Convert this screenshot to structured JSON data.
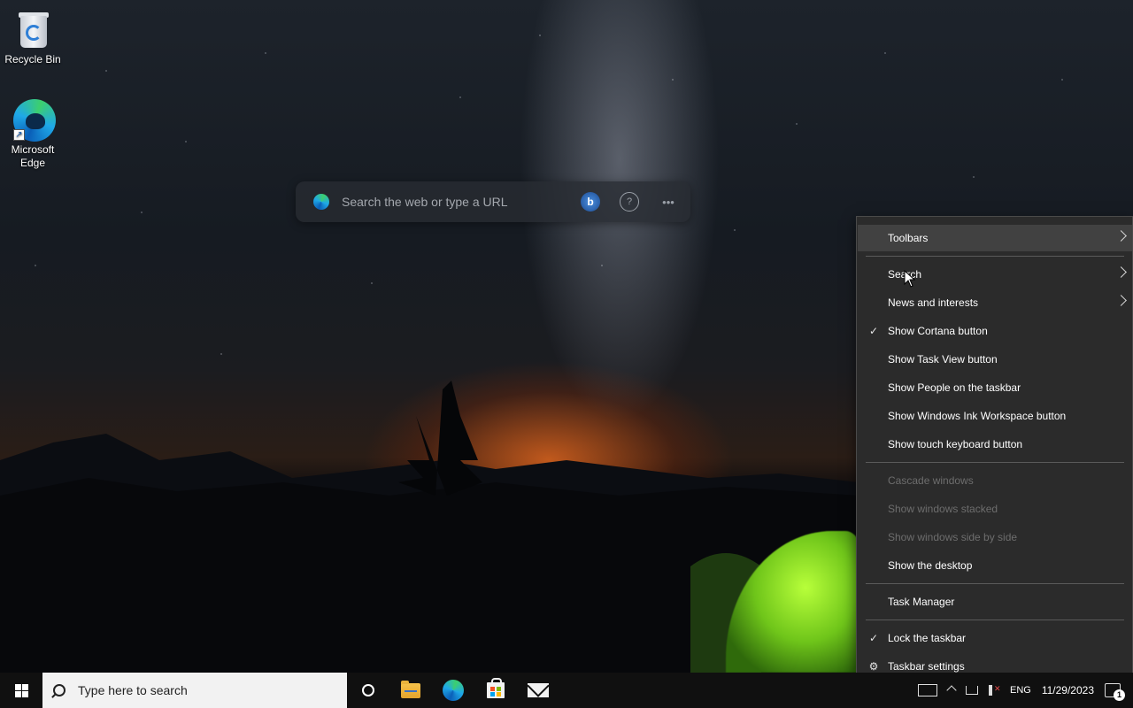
{
  "desktop": {
    "icons": [
      {
        "label": "Recycle Bin",
        "icon": "recycle-bin-icon"
      },
      {
        "label": "Microsoft\nEdge",
        "label_line1": "Microsoft",
        "label_line2": "Edge",
        "icon": "edge-icon"
      }
    ]
  },
  "edge_search": {
    "placeholder": "Search the web or type a URL",
    "bing_label": "b",
    "help_label": "?",
    "more_label": "•••"
  },
  "context_menu": {
    "items": [
      {
        "label": "Toolbars",
        "has_submenu": true,
        "checked": false,
        "enabled": true,
        "hovered": true
      },
      {
        "label": "Search",
        "has_submenu": true,
        "checked": false,
        "enabled": true
      },
      {
        "label": "News and interests",
        "has_submenu": true,
        "checked": false,
        "enabled": true
      },
      {
        "label": "Show Cortana button",
        "has_submenu": false,
        "checked": true,
        "enabled": true
      },
      {
        "label": "Show Task View button",
        "has_submenu": false,
        "checked": false,
        "enabled": true
      },
      {
        "label": "Show People on the taskbar",
        "has_submenu": false,
        "checked": false,
        "enabled": true
      },
      {
        "label": "Show Windows Ink Workspace button",
        "has_submenu": false,
        "checked": false,
        "enabled": true
      },
      {
        "label": "Show touch keyboard button",
        "has_submenu": false,
        "checked": false,
        "enabled": true
      },
      {
        "label": "Cascade windows",
        "has_submenu": false,
        "checked": false,
        "enabled": false
      },
      {
        "label": "Show windows stacked",
        "has_submenu": false,
        "checked": false,
        "enabled": false
      },
      {
        "label": "Show windows side by side",
        "has_submenu": false,
        "checked": false,
        "enabled": false
      },
      {
        "label": "Show the desktop",
        "has_submenu": false,
        "checked": false,
        "enabled": true
      },
      {
        "label": "Task Manager",
        "has_submenu": false,
        "checked": false,
        "enabled": true
      },
      {
        "label": "Lock the taskbar",
        "has_submenu": false,
        "checked": true,
        "enabled": true
      },
      {
        "label": "Taskbar settings",
        "has_submenu": false,
        "checked": false,
        "enabled": true,
        "icon": "gear-icon"
      }
    ],
    "check_glyph": "✓",
    "gear_glyph": "⚙"
  },
  "taskbar": {
    "search_placeholder": "Type here to search",
    "pinned": [
      "cortana-icon",
      "file-explorer-icon",
      "edge-icon",
      "store-icon",
      "mail-icon"
    ],
    "tray": {
      "language": "ENG",
      "date": "11/29/2023",
      "notification_count": "1"
    }
  },
  "colors": {
    "menu_bg": "#2b2b2b",
    "menu_hover": "#414141",
    "menu_disabled_text": "#6d6d6d",
    "taskbar_bg": "#101010",
    "search_box_bg": "#f2f2f2"
  }
}
